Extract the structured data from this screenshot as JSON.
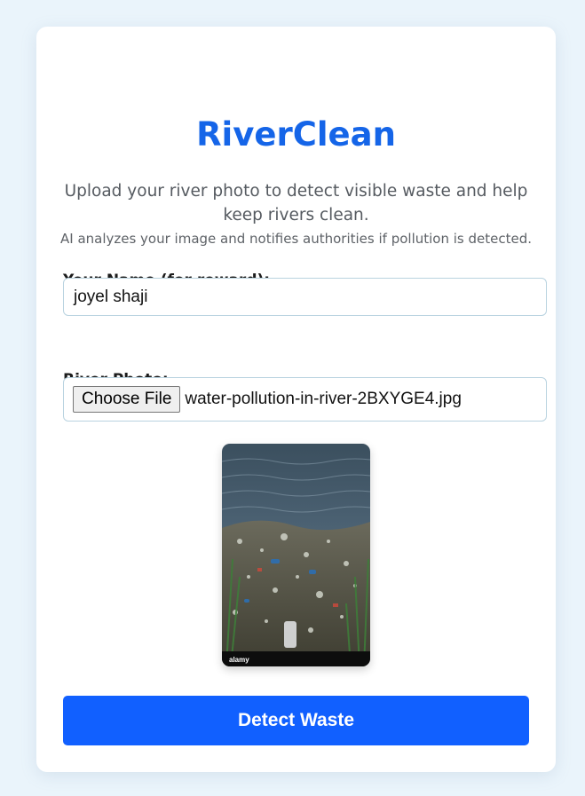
{
  "app": {
    "title": "RiverClean",
    "subtitle": "Upload your river photo to detect visible waste and help keep rivers clean.",
    "note": "AI analyzes your image and notifies authorities if pollution is detected."
  },
  "form": {
    "name_label": "Your Name (for reward):",
    "name_value": "joyel shaji",
    "photo_label": "River Photo:",
    "choose_file_label": "Choose File",
    "file_name": "water-pollution-in-river-2BXYGE4.jpg",
    "preview_watermark": "alamy",
    "submit_label": "Detect Waste"
  },
  "colors": {
    "accent": "#1565e8",
    "button": "#1160ff",
    "background": "#eaf4fb"
  }
}
